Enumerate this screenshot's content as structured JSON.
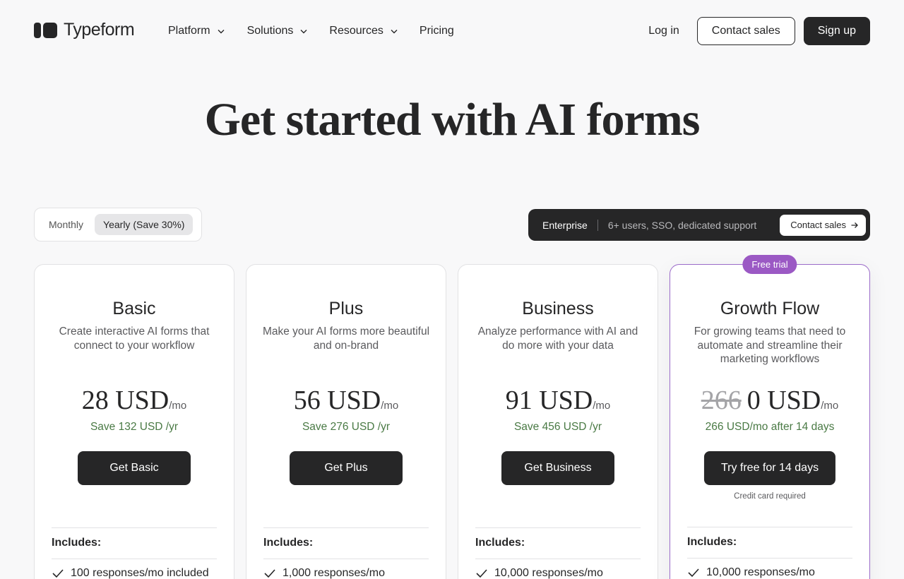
{
  "header": {
    "logo_text": "Typeform",
    "nav": [
      {
        "label": "Platform",
        "has_dropdown": true
      },
      {
        "label": "Solutions",
        "has_dropdown": true
      },
      {
        "label": "Resources",
        "has_dropdown": true
      },
      {
        "label": "Pricing",
        "has_dropdown": false
      }
    ],
    "login_label": "Log in",
    "contact_sales_label": "Contact sales",
    "signup_label": "Sign up"
  },
  "hero": {
    "title": "Get started with AI forms"
  },
  "billing_toggle": {
    "options": [
      "Monthly",
      "Yearly (Save 30%)"
    ],
    "selected": "Yearly (Save 30%)"
  },
  "enterprise": {
    "title": "Enterprise",
    "description": "6+ users, SSO, dedicated support",
    "button_label": "Contact sales"
  },
  "plans": [
    {
      "name": "Basic",
      "description": "Create interactive AI forms that connect to your workflow",
      "old_price": "",
      "price": "28 USD",
      "period": "/mo",
      "savings": "Save 132 USD /yr",
      "cta": "Get Basic",
      "note": "",
      "includes_label": "Includes:",
      "first_feature": "100 responses/mo included"
    },
    {
      "name": "Plus",
      "description": "Make your AI forms more beautiful and on-brand",
      "old_price": "",
      "price": "56 USD",
      "period": "/mo",
      "savings": "Save 276 USD /yr",
      "cta": "Get Plus",
      "note": "",
      "includes_label": "Includes:",
      "first_feature": "1,000 responses/mo"
    },
    {
      "name": "Business",
      "description": "Analyze performance with AI and do more with your data",
      "old_price": "",
      "price": "91 USD",
      "period": "/mo",
      "savings": "Save 456 USD /yr",
      "cta": "Get Business",
      "note": "",
      "includes_label": "Includes:",
      "first_feature": "10,000 responses/mo"
    },
    {
      "name": "Growth Flow",
      "badge": "Free trial",
      "description": "For growing teams that need to automate and streamline their marketing workflows",
      "old_price": "266",
      "price": "0 USD",
      "period": "/mo",
      "savings": "266 USD/mo after 14 days",
      "cta": "Try free for 14 days",
      "note": "Credit card required",
      "includes_label": "Includes:",
      "first_feature": "10,000 responses/mo"
    }
  ],
  "colors": {
    "dark": "#262627",
    "savings_green": "#4a7a45",
    "badge_purple": "#9b59c4",
    "background": "#f8f8f9"
  }
}
